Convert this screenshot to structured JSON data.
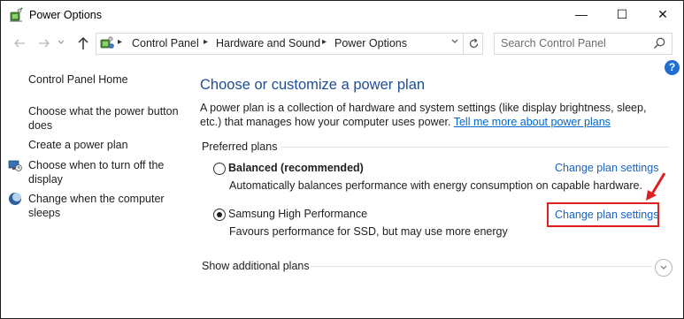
{
  "window": {
    "title": "Power Options",
    "controls": {
      "minimize": "—",
      "maximize": "☐",
      "close": "✕"
    }
  },
  "nav": {
    "breadcrumb": [
      "Control Panel",
      "Hardware and Sound",
      "Power Options"
    ],
    "search_placeholder": "Search Control Panel",
    "help": "?"
  },
  "sidebar": {
    "home": "Control Panel Home",
    "links": [
      "Choose what the power button does",
      "Create a power plan",
      "Choose when to turn off the display",
      "Change when the computer sleeps"
    ]
  },
  "main": {
    "heading": "Choose or customize a power plan",
    "description": "A power plan is a collection of hardware and system settings (like display brightness, sleep, etc.) that manages how your computer uses power.",
    "learn_more_link": "Tell me more about power plans",
    "preferred_label": "Preferred plans",
    "plans": [
      {
        "name": "Balanced (recommended)",
        "description": "Automatically balances performance with energy consumption on capable hardware.",
        "link": "Change plan settings",
        "selected": false
      },
      {
        "name": "Samsung High Performance",
        "description": "Favours performance for SSD, but may use more energy",
        "link": "Change plan settings",
        "selected": true
      }
    ],
    "show_additional": "Show additional plans"
  },
  "colors": {
    "heading": "#1f4e96",
    "link": "#1a62c4",
    "annotation": "#e02020",
    "help": "#1e6fd1"
  }
}
